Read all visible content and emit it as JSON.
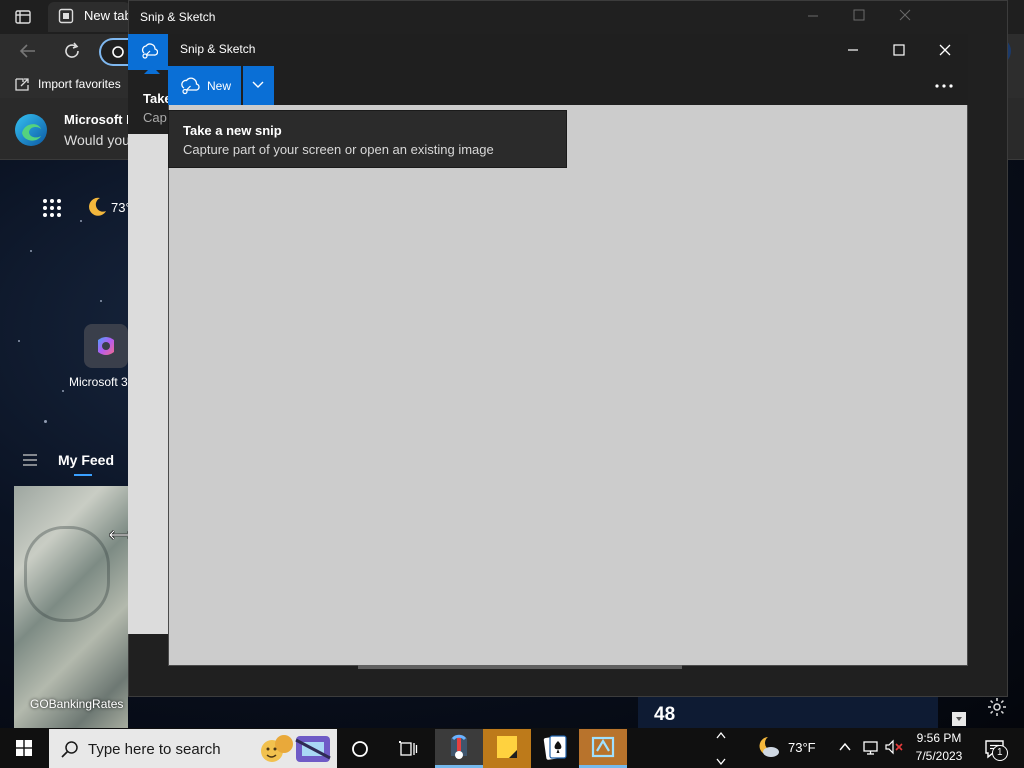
{
  "browser": {
    "tab_label": "New tab",
    "favorites_label": "Import favorites",
    "promo_title": "Microsoft E",
    "promo_text": "Would you",
    "weather_temp": "73°",
    "launcher_label": "Microsoft 3",
    "feed_label": "My Feed",
    "feed_card_source": "GOBankingRates",
    "bottom_card_number": "48"
  },
  "snip_back": {
    "title": "Snip & Sketch",
    "take_label_partial": "Take",
    "capture_label_partial": "Cap"
  },
  "snip": {
    "title": "Snip & Sketch",
    "new_label": "New",
    "tooltip_title": "Take a new snip",
    "tooltip_desc": "Capture part of your screen or open an existing image"
  },
  "taskbar": {
    "search_placeholder": "Type here to search",
    "temp": "73°F",
    "time": "9:56 PM",
    "date": "7/5/2023",
    "notification_count": "1"
  },
  "colors": {
    "accent": "#0a6fd6",
    "canvas": "#cccccc",
    "titlebar": "#1f1f1f"
  }
}
